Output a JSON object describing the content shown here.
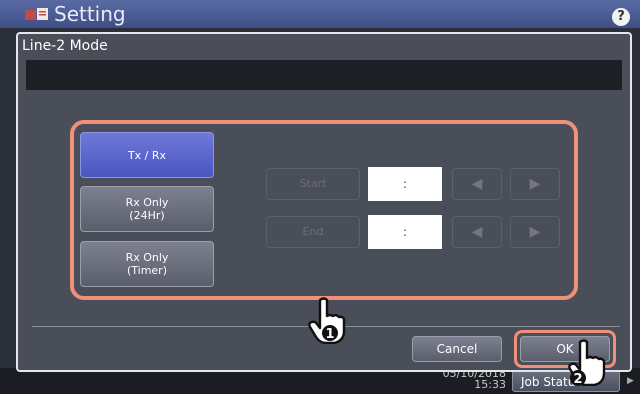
{
  "app": {
    "title": "Setting",
    "help_label": "?",
    "status": {
      "date": "05/10/2018",
      "time": "15:33",
      "job_label": "Job Status"
    }
  },
  "dialog": {
    "title": "Line-2 Mode",
    "message": "",
    "modes": [
      {
        "label": "Tx / Rx",
        "selected": true
      },
      {
        "label": "Rx Only\n(24Hr)",
        "selected": false
      },
      {
        "label": "Rx Only\n(Timer)",
        "selected": false
      }
    ],
    "start": {
      "label": "Start",
      "value": ":"
    },
    "end": {
      "label": "End",
      "value": ":"
    },
    "cancel_label": "Cancel",
    "ok_label": "OK"
  },
  "callouts": {
    "step1": "1",
    "step2": "2"
  },
  "colors": {
    "highlight": "#f09079",
    "selected_mode": "#5a64cc",
    "dialog_bg": "#4a4e59",
    "header": "#4c5c96"
  },
  "icons": {
    "left": "left-triangle-icon",
    "right": "right-triangle-icon",
    "pointer": "hand-pointer-icon"
  }
}
